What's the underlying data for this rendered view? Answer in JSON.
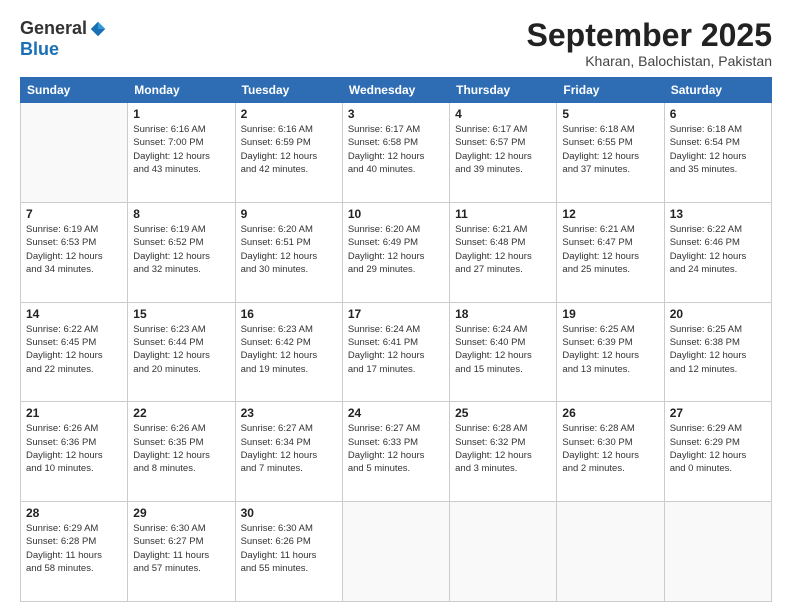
{
  "logo": {
    "general": "General",
    "blue": "Blue"
  },
  "title": "September 2025",
  "location": "Kharan, Balochistan, Pakistan",
  "weekdays": [
    "Sunday",
    "Monday",
    "Tuesday",
    "Wednesday",
    "Thursday",
    "Friday",
    "Saturday"
  ],
  "weeks": [
    [
      {
        "day": "",
        "info": ""
      },
      {
        "day": "1",
        "info": "Sunrise: 6:16 AM\nSunset: 7:00 PM\nDaylight: 12 hours\nand 43 minutes."
      },
      {
        "day": "2",
        "info": "Sunrise: 6:16 AM\nSunset: 6:59 PM\nDaylight: 12 hours\nand 42 minutes."
      },
      {
        "day": "3",
        "info": "Sunrise: 6:17 AM\nSunset: 6:58 PM\nDaylight: 12 hours\nand 40 minutes."
      },
      {
        "day": "4",
        "info": "Sunrise: 6:17 AM\nSunset: 6:57 PM\nDaylight: 12 hours\nand 39 minutes."
      },
      {
        "day": "5",
        "info": "Sunrise: 6:18 AM\nSunset: 6:55 PM\nDaylight: 12 hours\nand 37 minutes."
      },
      {
        "day": "6",
        "info": "Sunrise: 6:18 AM\nSunset: 6:54 PM\nDaylight: 12 hours\nand 35 minutes."
      }
    ],
    [
      {
        "day": "7",
        "info": "Sunrise: 6:19 AM\nSunset: 6:53 PM\nDaylight: 12 hours\nand 34 minutes."
      },
      {
        "day": "8",
        "info": "Sunrise: 6:19 AM\nSunset: 6:52 PM\nDaylight: 12 hours\nand 32 minutes."
      },
      {
        "day": "9",
        "info": "Sunrise: 6:20 AM\nSunset: 6:51 PM\nDaylight: 12 hours\nand 30 minutes."
      },
      {
        "day": "10",
        "info": "Sunrise: 6:20 AM\nSunset: 6:49 PM\nDaylight: 12 hours\nand 29 minutes."
      },
      {
        "day": "11",
        "info": "Sunrise: 6:21 AM\nSunset: 6:48 PM\nDaylight: 12 hours\nand 27 minutes."
      },
      {
        "day": "12",
        "info": "Sunrise: 6:21 AM\nSunset: 6:47 PM\nDaylight: 12 hours\nand 25 minutes."
      },
      {
        "day": "13",
        "info": "Sunrise: 6:22 AM\nSunset: 6:46 PM\nDaylight: 12 hours\nand 24 minutes."
      }
    ],
    [
      {
        "day": "14",
        "info": "Sunrise: 6:22 AM\nSunset: 6:45 PM\nDaylight: 12 hours\nand 22 minutes."
      },
      {
        "day": "15",
        "info": "Sunrise: 6:23 AM\nSunset: 6:44 PM\nDaylight: 12 hours\nand 20 minutes."
      },
      {
        "day": "16",
        "info": "Sunrise: 6:23 AM\nSunset: 6:42 PM\nDaylight: 12 hours\nand 19 minutes."
      },
      {
        "day": "17",
        "info": "Sunrise: 6:24 AM\nSunset: 6:41 PM\nDaylight: 12 hours\nand 17 minutes."
      },
      {
        "day": "18",
        "info": "Sunrise: 6:24 AM\nSunset: 6:40 PM\nDaylight: 12 hours\nand 15 minutes."
      },
      {
        "day": "19",
        "info": "Sunrise: 6:25 AM\nSunset: 6:39 PM\nDaylight: 12 hours\nand 13 minutes."
      },
      {
        "day": "20",
        "info": "Sunrise: 6:25 AM\nSunset: 6:38 PM\nDaylight: 12 hours\nand 12 minutes."
      }
    ],
    [
      {
        "day": "21",
        "info": "Sunrise: 6:26 AM\nSunset: 6:36 PM\nDaylight: 12 hours\nand 10 minutes."
      },
      {
        "day": "22",
        "info": "Sunrise: 6:26 AM\nSunset: 6:35 PM\nDaylight: 12 hours\nand 8 minutes."
      },
      {
        "day": "23",
        "info": "Sunrise: 6:27 AM\nSunset: 6:34 PM\nDaylight: 12 hours\nand 7 minutes."
      },
      {
        "day": "24",
        "info": "Sunrise: 6:27 AM\nSunset: 6:33 PM\nDaylight: 12 hours\nand 5 minutes."
      },
      {
        "day": "25",
        "info": "Sunrise: 6:28 AM\nSunset: 6:32 PM\nDaylight: 12 hours\nand 3 minutes."
      },
      {
        "day": "26",
        "info": "Sunrise: 6:28 AM\nSunset: 6:30 PM\nDaylight: 12 hours\nand 2 minutes."
      },
      {
        "day": "27",
        "info": "Sunrise: 6:29 AM\nSunset: 6:29 PM\nDaylight: 12 hours\nand 0 minutes."
      }
    ],
    [
      {
        "day": "28",
        "info": "Sunrise: 6:29 AM\nSunset: 6:28 PM\nDaylight: 11 hours\nand 58 minutes."
      },
      {
        "day": "29",
        "info": "Sunrise: 6:30 AM\nSunset: 6:27 PM\nDaylight: 11 hours\nand 57 minutes."
      },
      {
        "day": "30",
        "info": "Sunrise: 6:30 AM\nSunset: 6:26 PM\nDaylight: 11 hours\nand 55 minutes."
      },
      {
        "day": "",
        "info": ""
      },
      {
        "day": "",
        "info": ""
      },
      {
        "day": "",
        "info": ""
      },
      {
        "day": "",
        "info": ""
      }
    ]
  ]
}
